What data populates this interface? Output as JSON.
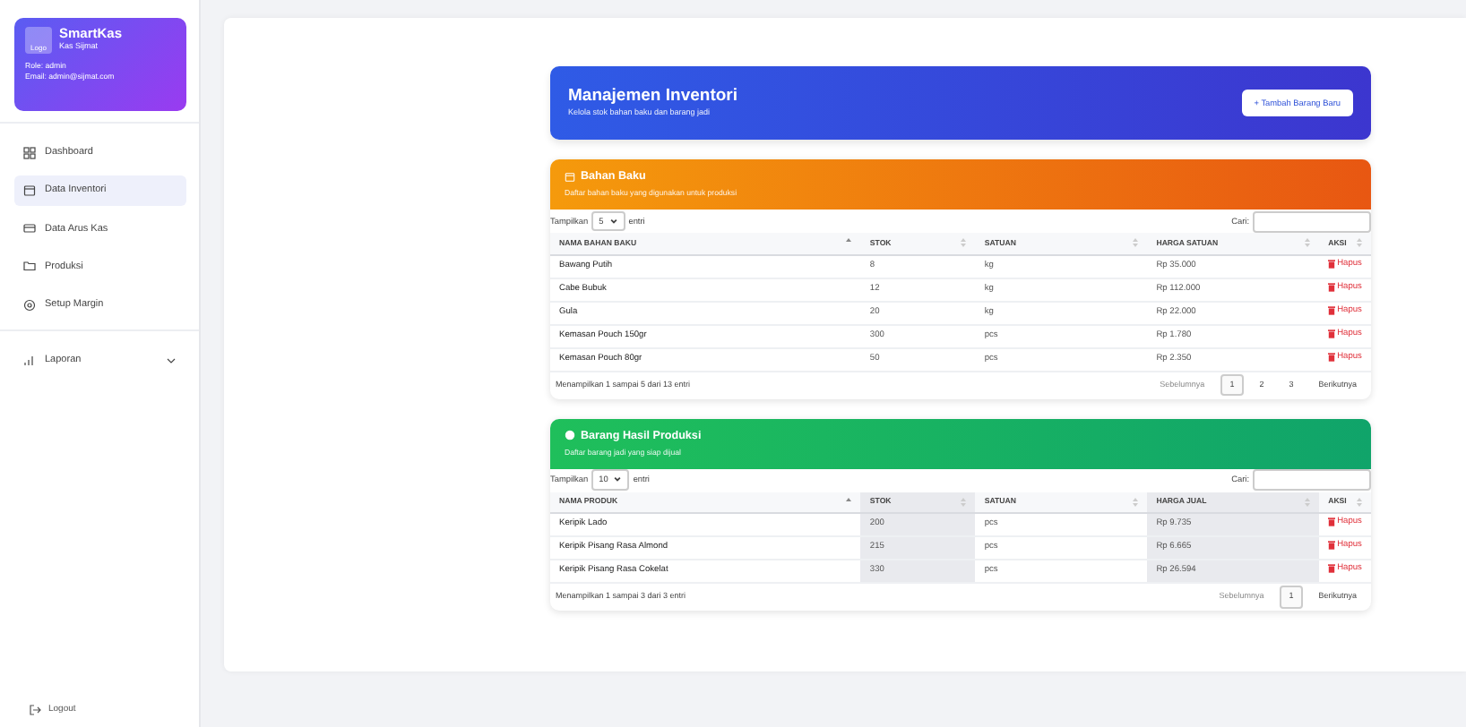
{
  "sidebar": {
    "brand": {
      "logo": "Logo",
      "title": "SmartKas",
      "subtitle": "Kas Sijmat",
      "role": "Role: admin",
      "email": "Email: admin@sijmat.com"
    },
    "items": [
      {
        "label": "Dashboard",
        "selected": false
      },
      {
        "label": "Data Inventori",
        "selected": true
      },
      {
        "label": "Data Arus Kas",
        "selected": false
      },
      {
        "label": "Produksi",
        "selected": false
      },
      {
        "label": "Setup Margin",
        "selected": false
      }
    ],
    "group": {
      "label": "Laporan",
      "expanded": false
    },
    "logout": "Logout"
  },
  "header": {
    "title": "Manajemen Inventori",
    "subtitle": "Kelola stok bahan baku dan barang jadi",
    "button": "+ Tambah Barang Baru"
  },
  "sections": [
    {
      "kind": "orange",
      "title": "Bahan Baku",
      "subtitle": "Daftar bahan baku yang digunakan untuk produksi",
      "show_label": "Tampilkan",
      "page_size": "5",
      "entries_label": "entri",
      "search_label": "Cari:",
      "columns": [
        {
          "label": "NAMA BAHAN BAKU",
          "sorted": true,
          "shaded": false
        },
        {
          "label": "STOK",
          "sorted": false,
          "shaded": false
        },
        {
          "label": "SATUAN",
          "sorted": false,
          "shaded": false
        },
        {
          "label": "HARGA SATUAN",
          "sorted": false,
          "shaded": false
        },
        {
          "label": "AKSI",
          "sorted": false,
          "shaded": false
        }
      ],
      "rows": [
        [
          "Bawang Putih",
          "8",
          "kg",
          "Rp 35.000",
          "Hapus"
        ],
        [
          "Cabe Bubuk",
          "12",
          "kg",
          "Rp 112.000",
          "Hapus"
        ],
        [
          "Gula",
          "20",
          "kg",
          "Rp 22.000",
          "Hapus"
        ],
        [
          "Kemasan Pouch 150gr",
          "300",
          "pcs",
          "Rp 1.780",
          "Hapus"
        ],
        [
          "Kemasan Pouch 80gr",
          "50",
          "pcs",
          "Rp 2.350",
          "Hapus"
        ]
      ],
      "info": "Menampilkan 1 sampai 5 dari 13 entri",
      "prev": "Sebelumnya",
      "next": "Berikutnya",
      "pages": [
        {
          "label": "1",
          "selected": true
        },
        {
          "label": "2",
          "selected": false
        },
        {
          "label": "3",
          "selected": false
        }
      ]
    },
    {
      "kind": "green",
      "title": "Barang Hasil Produksi",
      "subtitle": "Daftar barang jadi yang siap dijual",
      "show_label": "Tampilkan",
      "page_size": "10",
      "entries_label": "entri",
      "search_label": "Cari:",
      "columns": [
        {
          "label": "NAMA PRODUK",
          "sorted": true,
          "shaded": false
        },
        {
          "label": "STOK",
          "sorted": false,
          "shaded": true
        },
        {
          "label": "SATUAN",
          "sorted": false,
          "shaded": false
        },
        {
          "label": "HARGA JUAL",
          "sorted": false,
          "shaded": true
        },
        {
          "label": "AKSI",
          "sorted": false,
          "shaded": false
        }
      ],
      "rows": [
        [
          "Keripik Lado",
          "200",
          "pcs",
          "Rp 9.735",
          "Hapus"
        ],
        [
          "Keripik Pisang Rasa Almond",
          "215",
          "pcs",
          "Rp 6.665",
          "Hapus"
        ],
        [
          "Keripik Pisang Rasa Cokelat",
          "330",
          "pcs",
          "Rp 26.594",
          "Hapus"
        ]
      ],
      "info": "Menampilkan 1 sampai 3 dari 3 entri",
      "prev": "Sebelumnya",
      "next": "Berikutnya",
      "pages": [
        {
          "label": "1",
          "selected": true
        }
      ]
    }
  ]
}
